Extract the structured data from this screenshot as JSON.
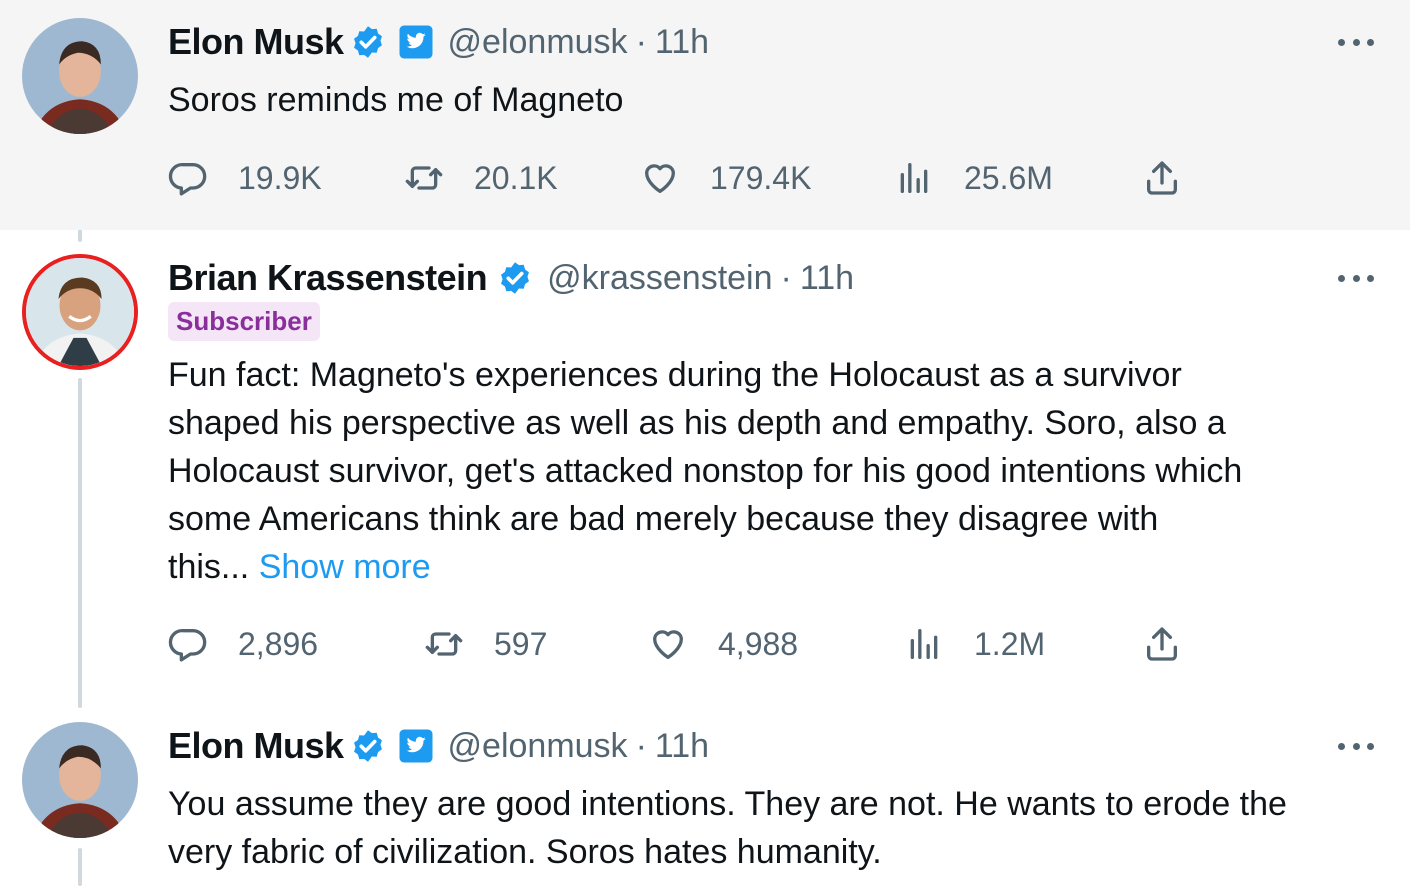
{
  "tweets": [
    {
      "name": "Elon Musk",
      "handle": "@elonmusk",
      "separator": "·",
      "time": "11h",
      "text": "Soros reminds me of Magneto",
      "stats": {
        "replies": "19.9K",
        "retweets": "20.1K",
        "likes": "179.4K",
        "views": "25.6M"
      }
    },
    {
      "name": "Brian Krassenstein",
      "handle": "@krassenstein",
      "separator": "·",
      "time": "11h",
      "badge": "Subscriber",
      "text_lines": [
        "Fun fact:  Magneto's experiences during the Holocaust as a survivor",
        "shaped his perspective as well as his depth and empathy.  Soro, also a",
        "Holocaust survivor, get's attacked nonstop for his good intentions which",
        "some Americans think are bad merely because they disagree with",
        "this..."
      ],
      "show_more": "Show more",
      "stats": {
        "replies": "2,896",
        "retweets": "597",
        "likes": "4,988",
        "views": "1.2M"
      }
    },
    {
      "name": "Elon Musk",
      "handle": "@elonmusk",
      "separator": "·",
      "time": "11h",
      "text_lines": [
        "You assume they are good intentions. They are not. He wants to erode the",
        "very fabric of civilization. Soros hates humanity."
      ]
    }
  ],
  "icons": {
    "verified": "verified-badge-icon",
    "government": "government-affiliation-icon",
    "reply": "reply-icon",
    "retweet": "retweet-icon",
    "like": "heart-icon",
    "views": "views-chart-icon",
    "share": "share-icon",
    "more": "more-options-icon"
  },
  "colors": {
    "verified": "#1d9bf0",
    "link": "#1d9bf0",
    "subscriber_bg": "#f4e6f6",
    "subscriber_text": "#8a2e9c",
    "avatar_ring": "#e8201f",
    "highlight_bg": "#f5f5f5"
  }
}
